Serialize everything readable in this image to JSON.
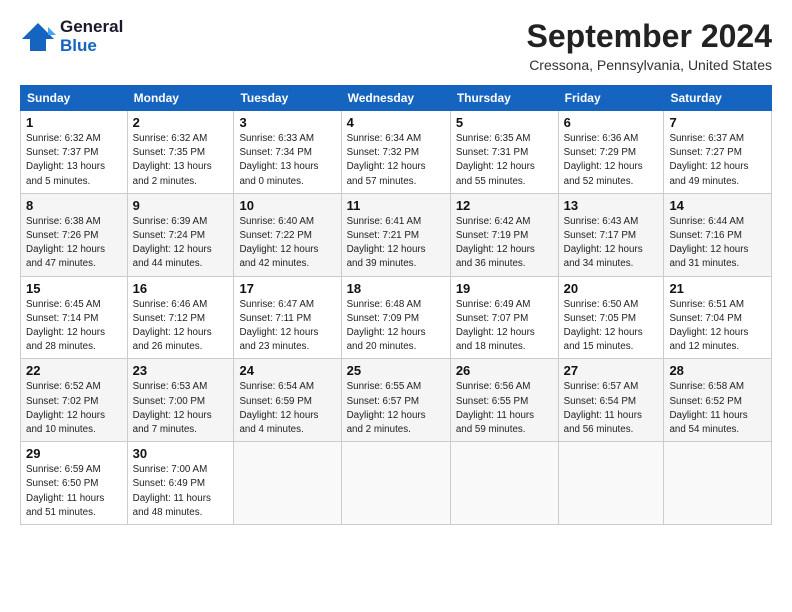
{
  "header": {
    "logo_line1": "General",
    "logo_line2": "Blue",
    "month": "September 2024",
    "location": "Cressona, Pennsylvania, United States"
  },
  "days_of_week": [
    "Sunday",
    "Monday",
    "Tuesday",
    "Wednesday",
    "Thursday",
    "Friday",
    "Saturday"
  ],
  "weeks": [
    [
      {
        "day": "1",
        "info": "Sunrise: 6:32 AM\nSunset: 7:37 PM\nDaylight: 13 hours\nand 5 minutes."
      },
      {
        "day": "2",
        "info": "Sunrise: 6:32 AM\nSunset: 7:35 PM\nDaylight: 13 hours\nand 2 minutes."
      },
      {
        "day": "3",
        "info": "Sunrise: 6:33 AM\nSunset: 7:34 PM\nDaylight: 13 hours\nand 0 minutes."
      },
      {
        "day": "4",
        "info": "Sunrise: 6:34 AM\nSunset: 7:32 PM\nDaylight: 12 hours\nand 57 minutes."
      },
      {
        "day": "5",
        "info": "Sunrise: 6:35 AM\nSunset: 7:31 PM\nDaylight: 12 hours\nand 55 minutes."
      },
      {
        "day": "6",
        "info": "Sunrise: 6:36 AM\nSunset: 7:29 PM\nDaylight: 12 hours\nand 52 minutes."
      },
      {
        "day": "7",
        "info": "Sunrise: 6:37 AM\nSunset: 7:27 PM\nDaylight: 12 hours\nand 49 minutes."
      }
    ],
    [
      {
        "day": "8",
        "info": "Sunrise: 6:38 AM\nSunset: 7:26 PM\nDaylight: 12 hours\nand 47 minutes."
      },
      {
        "day": "9",
        "info": "Sunrise: 6:39 AM\nSunset: 7:24 PM\nDaylight: 12 hours\nand 44 minutes."
      },
      {
        "day": "10",
        "info": "Sunrise: 6:40 AM\nSunset: 7:22 PM\nDaylight: 12 hours\nand 42 minutes."
      },
      {
        "day": "11",
        "info": "Sunrise: 6:41 AM\nSunset: 7:21 PM\nDaylight: 12 hours\nand 39 minutes."
      },
      {
        "day": "12",
        "info": "Sunrise: 6:42 AM\nSunset: 7:19 PM\nDaylight: 12 hours\nand 36 minutes."
      },
      {
        "day": "13",
        "info": "Sunrise: 6:43 AM\nSunset: 7:17 PM\nDaylight: 12 hours\nand 34 minutes."
      },
      {
        "day": "14",
        "info": "Sunrise: 6:44 AM\nSunset: 7:16 PM\nDaylight: 12 hours\nand 31 minutes."
      }
    ],
    [
      {
        "day": "15",
        "info": "Sunrise: 6:45 AM\nSunset: 7:14 PM\nDaylight: 12 hours\nand 28 minutes."
      },
      {
        "day": "16",
        "info": "Sunrise: 6:46 AM\nSunset: 7:12 PM\nDaylight: 12 hours\nand 26 minutes."
      },
      {
        "day": "17",
        "info": "Sunrise: 6:47 AM\nSunset: 7:11 PM\nDaylight: 12 hours\nand 23 minutes."
      },
      {
        "day": "18",
        "info": "Sunrise: 6:48 AM\nSunset: 7:09 PM\nDaylight: 12 hours\nand 20 minutes."
      },
      {
        "day": "19",
        "info": "Sunrise: 6:49 AM\nSunset: 7:07 PM\nDaylight: 12 hours\nand 18 minutes."
      },
      {
        "day": "20",
        "info": "Sunrise: 6:50 AM\nSunset: 7:05 PM\nDaylight: 12 hours\nand 15 minutes."
      },
      {
        "day": "21",
        "info": "Sunrise: 6:51 AM\nSunset: 7:04 PM\nDaylight: 12 hours\nand 12 minutes."
      }
    ],
    [
      {
        "day": "22",
        "info": "Sunrise: 6:52 AM\nSunset: 7:02 PM\nDaylight: 12 hours\nand 10 minutes."
      },
      {
        "day": "23",
        "info": "Sunrise: 6:53 AM\nSunset: 7:00 PM\nDaylight: 12 hours\nand 7 minutes."
      },
      {
        "day": "24",
        "info": "Sunrise: 6:54 AM\nSunset: 6:59 PM\nDaylight: 12 hours\nand 4 minutes."
      },
      {
        "day": "25",
        "info": "Sunrise: 6:55 AM\nSunset: 6:57 PM\nDaylight: 12 hours\nand 2 minutes."
      },
      {
        "day": "26",
        "info": "Sunrise: 6:56 AM\nSunset: 6:55 PM\nDaylight: 11 hours\nand 59 minutes."
      },
      {
        "day": "27",
        "info": "Sunrise: 6:57 AM\nSunset: 6:54 PM\nDaylight: 11 hours\nand 56 minutes."
      },
      {
        "day": "28",
        "info": "Sunrise: 6:58 AM\nSunset: 6:52 PM\nDaylight: 11 hours\nand 54 minutes."
      }
    ],
    [
      {
        "day": "29",
        "info": "Sunrise: 6:59 AM\nSunset: 6:50 PM\nDaylight: 11 hours\nand 51 minutes."
      },
      {
        "day": "30",
        "info": "Sunrise: 7:00 AM\nSunset: 6:49 PM\nDaylight: 11 hours\nand 48 minutes."
      },
      {
        "day": "",
        "info": ""
      },
      {
        "day": "",
        "info": ""
      },
      {
        "day": "",
        "info": ""
      },
      {
        "day": "",
        "info": ""
      },
      {
        "day": "",
        "info": ""
      }
    ]
  ]
}
